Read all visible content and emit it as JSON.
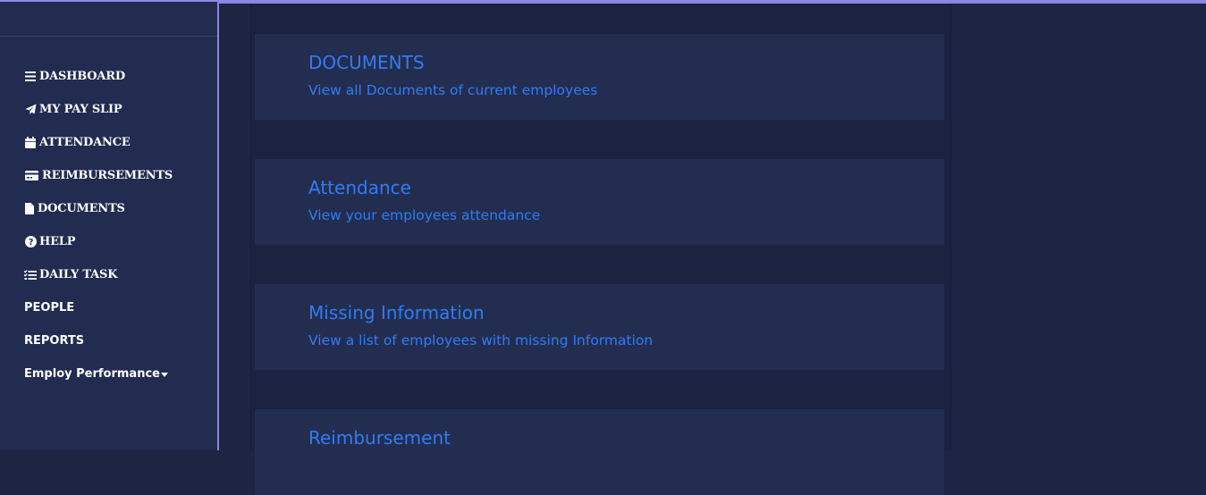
{
  "sidebar": {
    "items": [
      {
        "label": "DASHBOARD",
        "icon": "bars-icon"
      },
      {
        "label": "MY PAY SLIP",
        "icon": "paper-plane-icon"
      },
      {
        "label": "ATTENDANCE",
        "icon": "calendar-icon"
      },
      {
        "label": "REIMBURSEMENTS",
        "icon": "credit-card-icon"
      },
      {
        "label": "DOCUMENTS",
        "icon": "file-icon"
      },
      {
        "label": "HELP",
        "icon": "question-circle-icon"
      },
      {
        "label": "DAILY TASK",
        "icon": "task-list-icon"
      },
      {
        "label": "PEOPLE"
      },
      {
        "label": "REPORTS"
      },
      {
        "label": "Employ Performance",
        "icon": "caret-down-icon"
      }
    ]
  },
  "cards": [
    {
      "title": "DOCUMENTS",
      "desc": "View all Documents of current employees"
    },
    {
      "title": "Attendance",
      "desc": "View your employees attendance"
    },
    {
      "title": "Missing Information",
      "desc": "View a list of employees with missing Information"
    },
    {
      "title": "Reimbursement",
      "desc": ""
    }
  ],
  "colors": {
    "accent": "#8a86e8",
    "link": "#2f7cf6",
    "sidebar_bg": "#222b50",
    "card_bg": "#232d50",
    "page_bg": "#1d2542"
  }
}
